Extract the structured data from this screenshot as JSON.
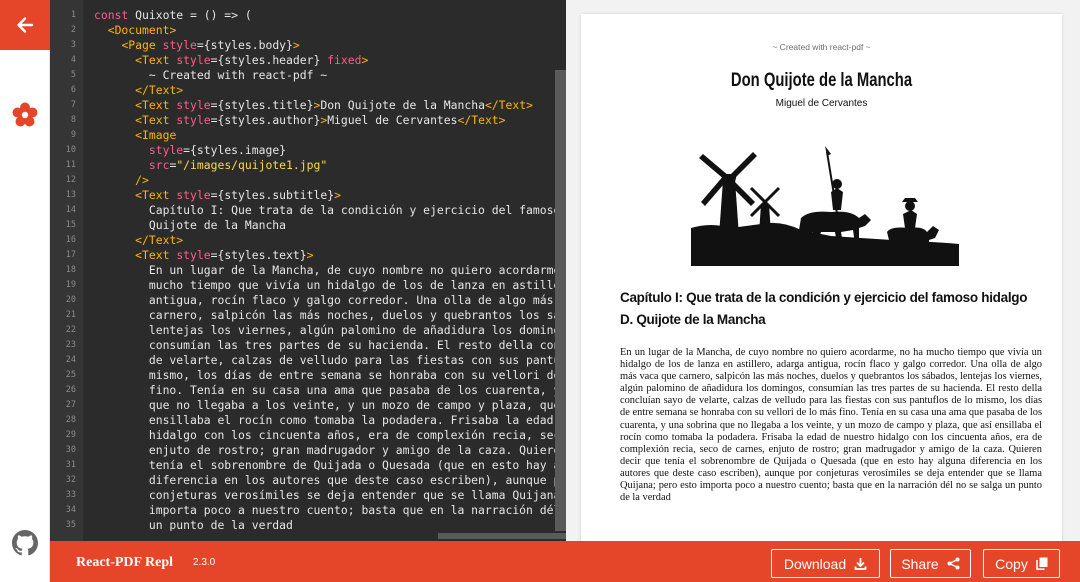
{
  "app": {
    "name": "React-PDF Repl",
    "version": "2.3.0"
  },
  "sidebar": {
    "back_icon": "arrow-left-icon",
    "logo_icon": "react-pdf-logo-icon",
    "github_icon": "github-icon",
    "accent_color": "#e54528"
  },
  "editor": {
    "line_numbers": [
      "1",
      "2",
      "3",
      "4",
      "5",
      "6",
      "7",
      "8",
      "9",
      "10",
      "11",
      "12",
      "13",
      "14",
      "15",
      "16",
      "17",
      "18",
      "19",
      "20",
      "21",
      "22",
      "23",
      "24",
      "25",
      "26",
      "27",
      "28",
      "29",
      "30",
      "31",
      "32",
      "33",
      "34",
      "35"
    ],
    "lines": [
      [
        {
          "c": "kw",
          "t": "const"
        },
        {
          "c": "txt",
          "t": " Quixote = () => ("
        }
      ],
      [
        {
          "c": "txt",
          "t": "  "
        },
        {
          "c": "tag",
          "t": "<Document>"
        }
      ],
      [
        {
          "c": "txt",
          "t": "    "
        },
        {
          "c": "tag",
          "t": "<Page "
        },
        {
          "c": "attr",
          "t": "style"
        },
        {
          "c": "txt",
          "t": "={styles.body}"
        },
        {
          "c": "tag",
          "t": ">"
        }
      ],
      [
        {
          "c": "txt",
          "t": "      "
        },
        {
          "c": "tag",
          "t": "<Text "
        },
        {
          "c": "attr",
          "t": "style"
        },
        {
          "c": "txt",
          "t": "={styles.header} "
        },
        {
          "c": "attr",
          "t": "fixed"
        },
        {
          "c": "tag",
          "t": ">"
        }
      ],
      [
        {
          "c": "txt",
          "t": "        ~ Created with react-pdf ~"
        }
      ],
      [
        {
          "c": "txt",
          "t": "      "
        },
        {
          "c": "tag",
          "t": "</Text>"
        }
      ],
      [
        {
          "c": "txt",
          "t": "      "
        },
        {
          "c": "tag",
          "t": "<Text "
        },
        {
          "c": "attr",
          "t": "style"
        },
        {
          "c": "txt",
          "t": "={styles.title}"
        },
        {
          "c": "tag",
          "t": ">"
        },
        {
          "c": "txt",
          "t": "Don Quijote de la Mancha"
        },
        {
          "c": "tag",
          "t": "</Text>"
        }
      ],
      [
        {
          "c": "txt",
          "t": "      "
        },
        {
          "c": "tag",
          "t": "<Text "
        },
        {
          "c": "attr",
          "t": "style"
        },
        {
          "c": "txt",
          "t": "={styles.author}"
        },
        {
          "c": "tag",
          "t": ">"
        },
        {
          "c": "txt",
          "t": "Miguel de Cervantes"
        },
        {
          "c": "tag",
          "t": "</Text>"
        }
      ],
      [
        {
          "c": "txt",
          "t": "      "
        },
        {
          "c": "tag",
          "t": "<Image"
        }
      ],
      [
        {
          "c": "txt",
          "t": "        "
        },
        {
          "c": "attr",
          "t": "style"
        },
        {
          "c": "txt",
          "t": "={styles.image}"
        }
      ],
      [
        {
          "c": "txt",
          "t": "        "
        },
        {
          "c": "attr",
          "t": "src"
        },
        {
          "c": "txt",
          "t": "="
        },
        {
          "c": "str",
          "t": "\"/images/quijote1.jpg\""
        }
      ],
      [
        {
          "c": "txt",
          "t": "      "
        },
        {
          "c": "tag",
          "t": "/>"
        }
      ],
      [
        {
          "c": "txt",
          "t": "      "
        },
        {
          "c": "tag",
          "t": "<Text "
        },
        {
          "c": "attr",
          "t": "style"
        },
        {
          "c": "txt",
          "t": "={styles.subtitle}"
        },
        {
          "c": "tag",
          "t": ">"
        }
      ],
      [
        {
          "c": "txt",
          "t": "        Capítulo I: Que trata de la condición y ejercicio del famoso hidalgo D."
        }
      ],
      [
        {
          "c": "txt",
          "t": "        Quijote de la Mancha"
        }
      ],
      [
        {
          "c": "txt",
          "t": "      "
        },
        {
          "c": "tag",
          "t": "</Text>"
        }
      ],
      [
        {
          "c": "txt",
          "t": "      "
        },
        {
          "c": "tag",
          "t": "<Text "
        },
        {
          "c": "attr",
          "t": "style"
        },
        {
          "c": "txt",
          "t": "={styles.text}"
        },
        {
          "c": "tag",
          "t": ">"
        }
      ],
      [
        {
          "c": "txt",
          "t": "        En un lugar de la Mancha, de cuyo nombre no quiero acordarme, no ha"
        }
      ],
      [
        {
          "c": "txt",
          "t": "        mucho tiempo que vivía un hidalgo de los de lanza en astillero, adarga"
        }
      ],
      [
        {
          "c": "txt",
          "t": "        antigua, rocín flaco y galgo corredor. Una olla de algo más vaca que"
        }
      ],
      [
        {
          "c": "txt",
          "t": "        carnero, salpicón las más noches, duelos y quebrantos los sábados,"
        }
      ],
      [
        {
          "c": "txt",
          "t": "        lentejas los viernes, algún palomino de añadidura los domingos,"
        }
      ],
      [
        {
          "c": "txt",
          "t": "        consumían las tres partes de su hacienda. El resto della concluían sayo"
        }
      ],
      [
        {
          "c": "txt",
          "t": "        de velarte, calzas de velludo para las fiestas con sus pantuflos de lo"
        }
      ],
      [
        {
          "c": "txt",
          "t": "        mismo, los días de entre semana se honraba con su vellori de lo más"
        }
      ],
      [
        {
          "c": "txt",
          "t": "        fino. Tenía en su casa una ama que pasaba de los cuarenta, y una sobrina"
        }
      ],
      [
        {
          "c": "txt",
          "t": "        que no llegaba a los veinte, y un mozo de campo y plaza, que así"
        }
      ],
      [
        {
          "c": "txt",
          "t": "        ensillaba el rocín como tomaba la podadera. Frisaba la edad de nuestro"
        }
      ],
      [
        {
          "c": "txt",
          "t": "        hidalgo con los cincuenta años, era de complexión recia, seco de carnes,"
        }
      ],
      [
        {
          "c": "txt",
          "t": "        enjuto de rostro; gran madrugador y amigo de la caza. Quieren decir que"
        }
      ],
      [
        {
          "c": "txt",
          "t": "        tenía el sobrenombre de Quijada o Quesada (que en esto hay alguna"
        }
      ],
      [
        {
          "c": "txt",
          "t": "        diferencia en los autores que deste caso escriben), aunque por"
        }
      ],
      [
        {
          "c": "txt",
          "t": "        conjeturas verosímiles se deja entender que se llama Quijana; pero esto"
        }
      ],
      [
        {
          "c": "txt",
          "t": "        importa poco a nuestro cuento; basta que en la narración dél no se"
        }
      ],
      [
        {
          "c": "txt",
          "t": "        un punto de la verdad"
        }
      ]
    ]
  },
  "preview": {
    "header": "~ Created with react-pdf ~",
    "title": "Don Quijote de la Mancha",
    "author": "Miguel de Cervantes",
    "image_icon": "don-quixote-illustration",
    "subtitle": "Capítulo I: Que trata de la condición y ejercicio del famoso hidalgo D. Quijote de la Mancha",
    "text": "En un lugar de la Mancha, de cuyo nombre no quiero acordarme, no ha mucho tiempo que vivía un hidalgo de los de lanza en astillero, adarga antigua, rocín flaco y galgo corredor. Una olla de algo más vaca que carnero, salpicón las más noches, duelos y quebrantos los sábados, lentejas los viernes, algún palomino de añadidura los domingos, consumían las tres partes de su hacienda. El resto della concluían sayo de velarte, calzas de velludo para las fiestas con sus pantuflos de lo mismo, los días de entre semana se honraba con su vellori de lo más fino. Tenía en su casa una ama que pasaba de los cuarenta, y una sobrina que no llegaba a los veinte, y un mozo de campo y plaza, que así ensillaba el rocín como tomaba la podadera. Frisaba la edad de nuestro hidalgo con los cincuenta años, era de complexión recia, seco de carnes, enjuto de rostro; gran madrugador y amigo de la caza. Quieren decir que tenía el sobrenombre de Quijada o Quesada (que en esto hay alguna diferencia en los autores que deste caso escriben), aunque por conjeturas verosímiles se deja entender que se llama Quijana; pero esto importa poco a nuestro cuento; basta que en la narración dél no se salga un punto de la verdad"
  },
  "toolbar": {
    "download_label": "Download",
    "download_icon": "download-icon",
    "share_label": "Share",
    "share_icon": "share-icon",
    "copy_label": "Copy",
    "copy_icon": "copy-icon"
  }
}
